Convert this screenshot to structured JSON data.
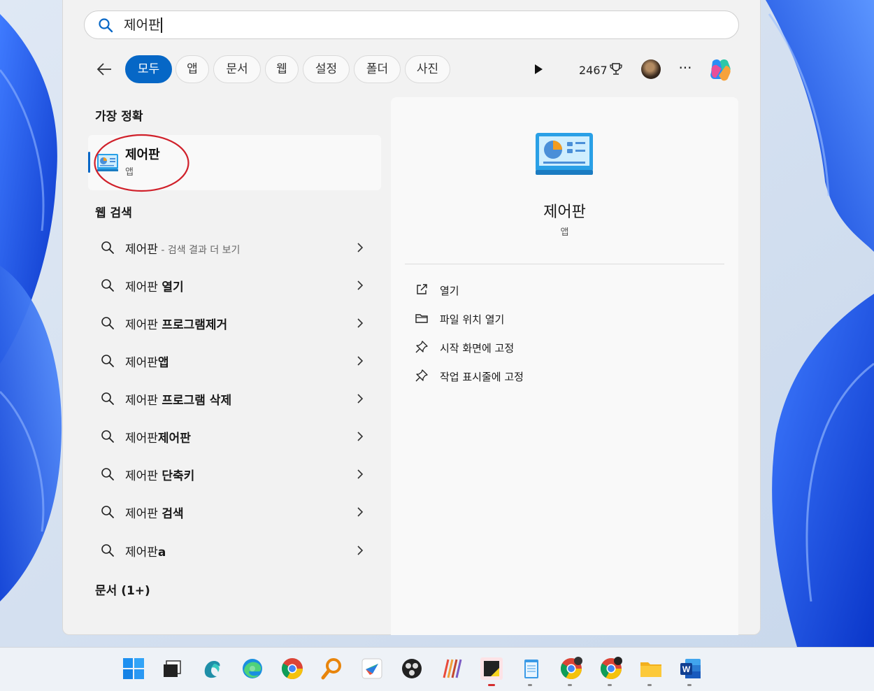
{
  "search": {
    "query": "제어판"
  },
  "filters": {
    "chips": [
      "모두",
      "앱",
      "문서",
      "웹",
      "설정",
      "폴더",
      "사진"
    ],
    "active": "모두",
    "points": "2467"
  },
  "best_match": {
    "title": "가장 정확",
    "name": "제어판",
    "type": "앱"
  },
  "web_search": {
    "title": "웹 검색",
    "items": [
      {
        "base": "제어판",
        "bold": "",
        "extra": " - 검색 결과 더 보기"
      },
      {
        "base": "제어판 ",
        "bold": "열기",
        "extra": ""
      },
      {
        "base": "제어판 ",
        "bold": "프로그램제거",
        "extra": ""
      },
      {
        "base": "제어판",
        "bold": "앱",
        "extra": ""
      },
      {
        "base": "제어판 ",
        "bold": "프로그램 삭제",
        "extra": ""
      },
      {
        "base": "제어판",
        "bold": "제어판",
        "extra": ""
      },
      {
        "base": "제어판 ",
        "bold": "단축키",
        "extra": ""
      },
      {
        "base": "제어판 ",
        "bold": "검색",
        "extra": ""
      },
      {
        "base": "제어판",
        "bold": "a",
        "extra": ""
      }
    ]
  },
  "documents": {
    "title": "문서 (1+)"
  },
  "preview": {
    "name": "제어판",
    "type": "앱",
    "actions": [
      {
        "label": "열기",
        "icon": "open-external-icon"
      },
      {
        "label": "파일 위치 열기",
        "icon": "folder-icon"
      },
      {
        "label": "시작 화면에 고정",
        "icon": "pin-icon"
      },
      {
        "label": "작업 표시줄에 고정",
        "icon": "pin-icon"
      }
    ]
  },
  "taskbar": {
    "icons": [
      "windows-start-icon",
      "task-view-icon",
      "copilot-app-icon",
      "edge-icon",
      "chrome-icon",
      "magnifier-search-icon",
      "pen-app-icon",
      "obs-icon",
      "sticks-app-icon",
      "sticky-notes-icon",
      "notepad-icon",
      "chrome-profile-icon",
      "chrome-profile-icon",
      "file-explorer-icon",
      "word-icon"
    ]
  },
  "colors": {
    "accent": "#0667c6",
    "highlight_circle": "#d0202a"
  }
}
